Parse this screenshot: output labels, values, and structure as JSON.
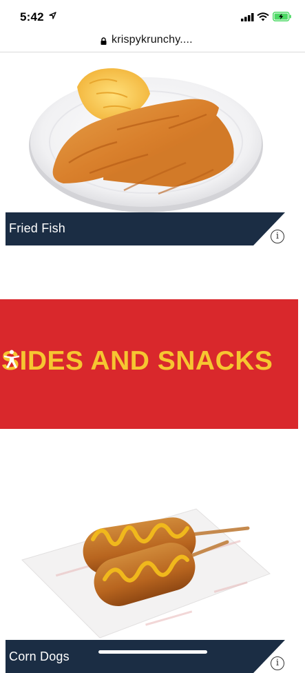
{
  "status_bar": {
    "time": "5:42",
    "icons": [
      "location-arrow-icon",
      "signal-bars-icon",
      "wifi-icon",
      "battery-charging-icon"
    ]
  },
  "browser": {
    "url": "krispykrunchy....",
    "lock_icon": "lock-icon"
  },
  "products": [
    {
      "name": "Fried Fish",
      "info_icon": "info-icon",
      "info_glyph": "i"
    },
    {
      "name": "Corn Dogs",
      "info_icon": "info-icon",
      "info_glyph": "i"
    }
  ],
  "section": {
    "title": "SIDES AND SNACKS",
    "icon": "accessibility-person-icon"
  },
  "colors": {
    "navy_banner": "#1b2d44",
    "red_section": "#d9282c",
    "section_text": "#f6c631",
    "battery_green": "#4cd964"
  }
}
